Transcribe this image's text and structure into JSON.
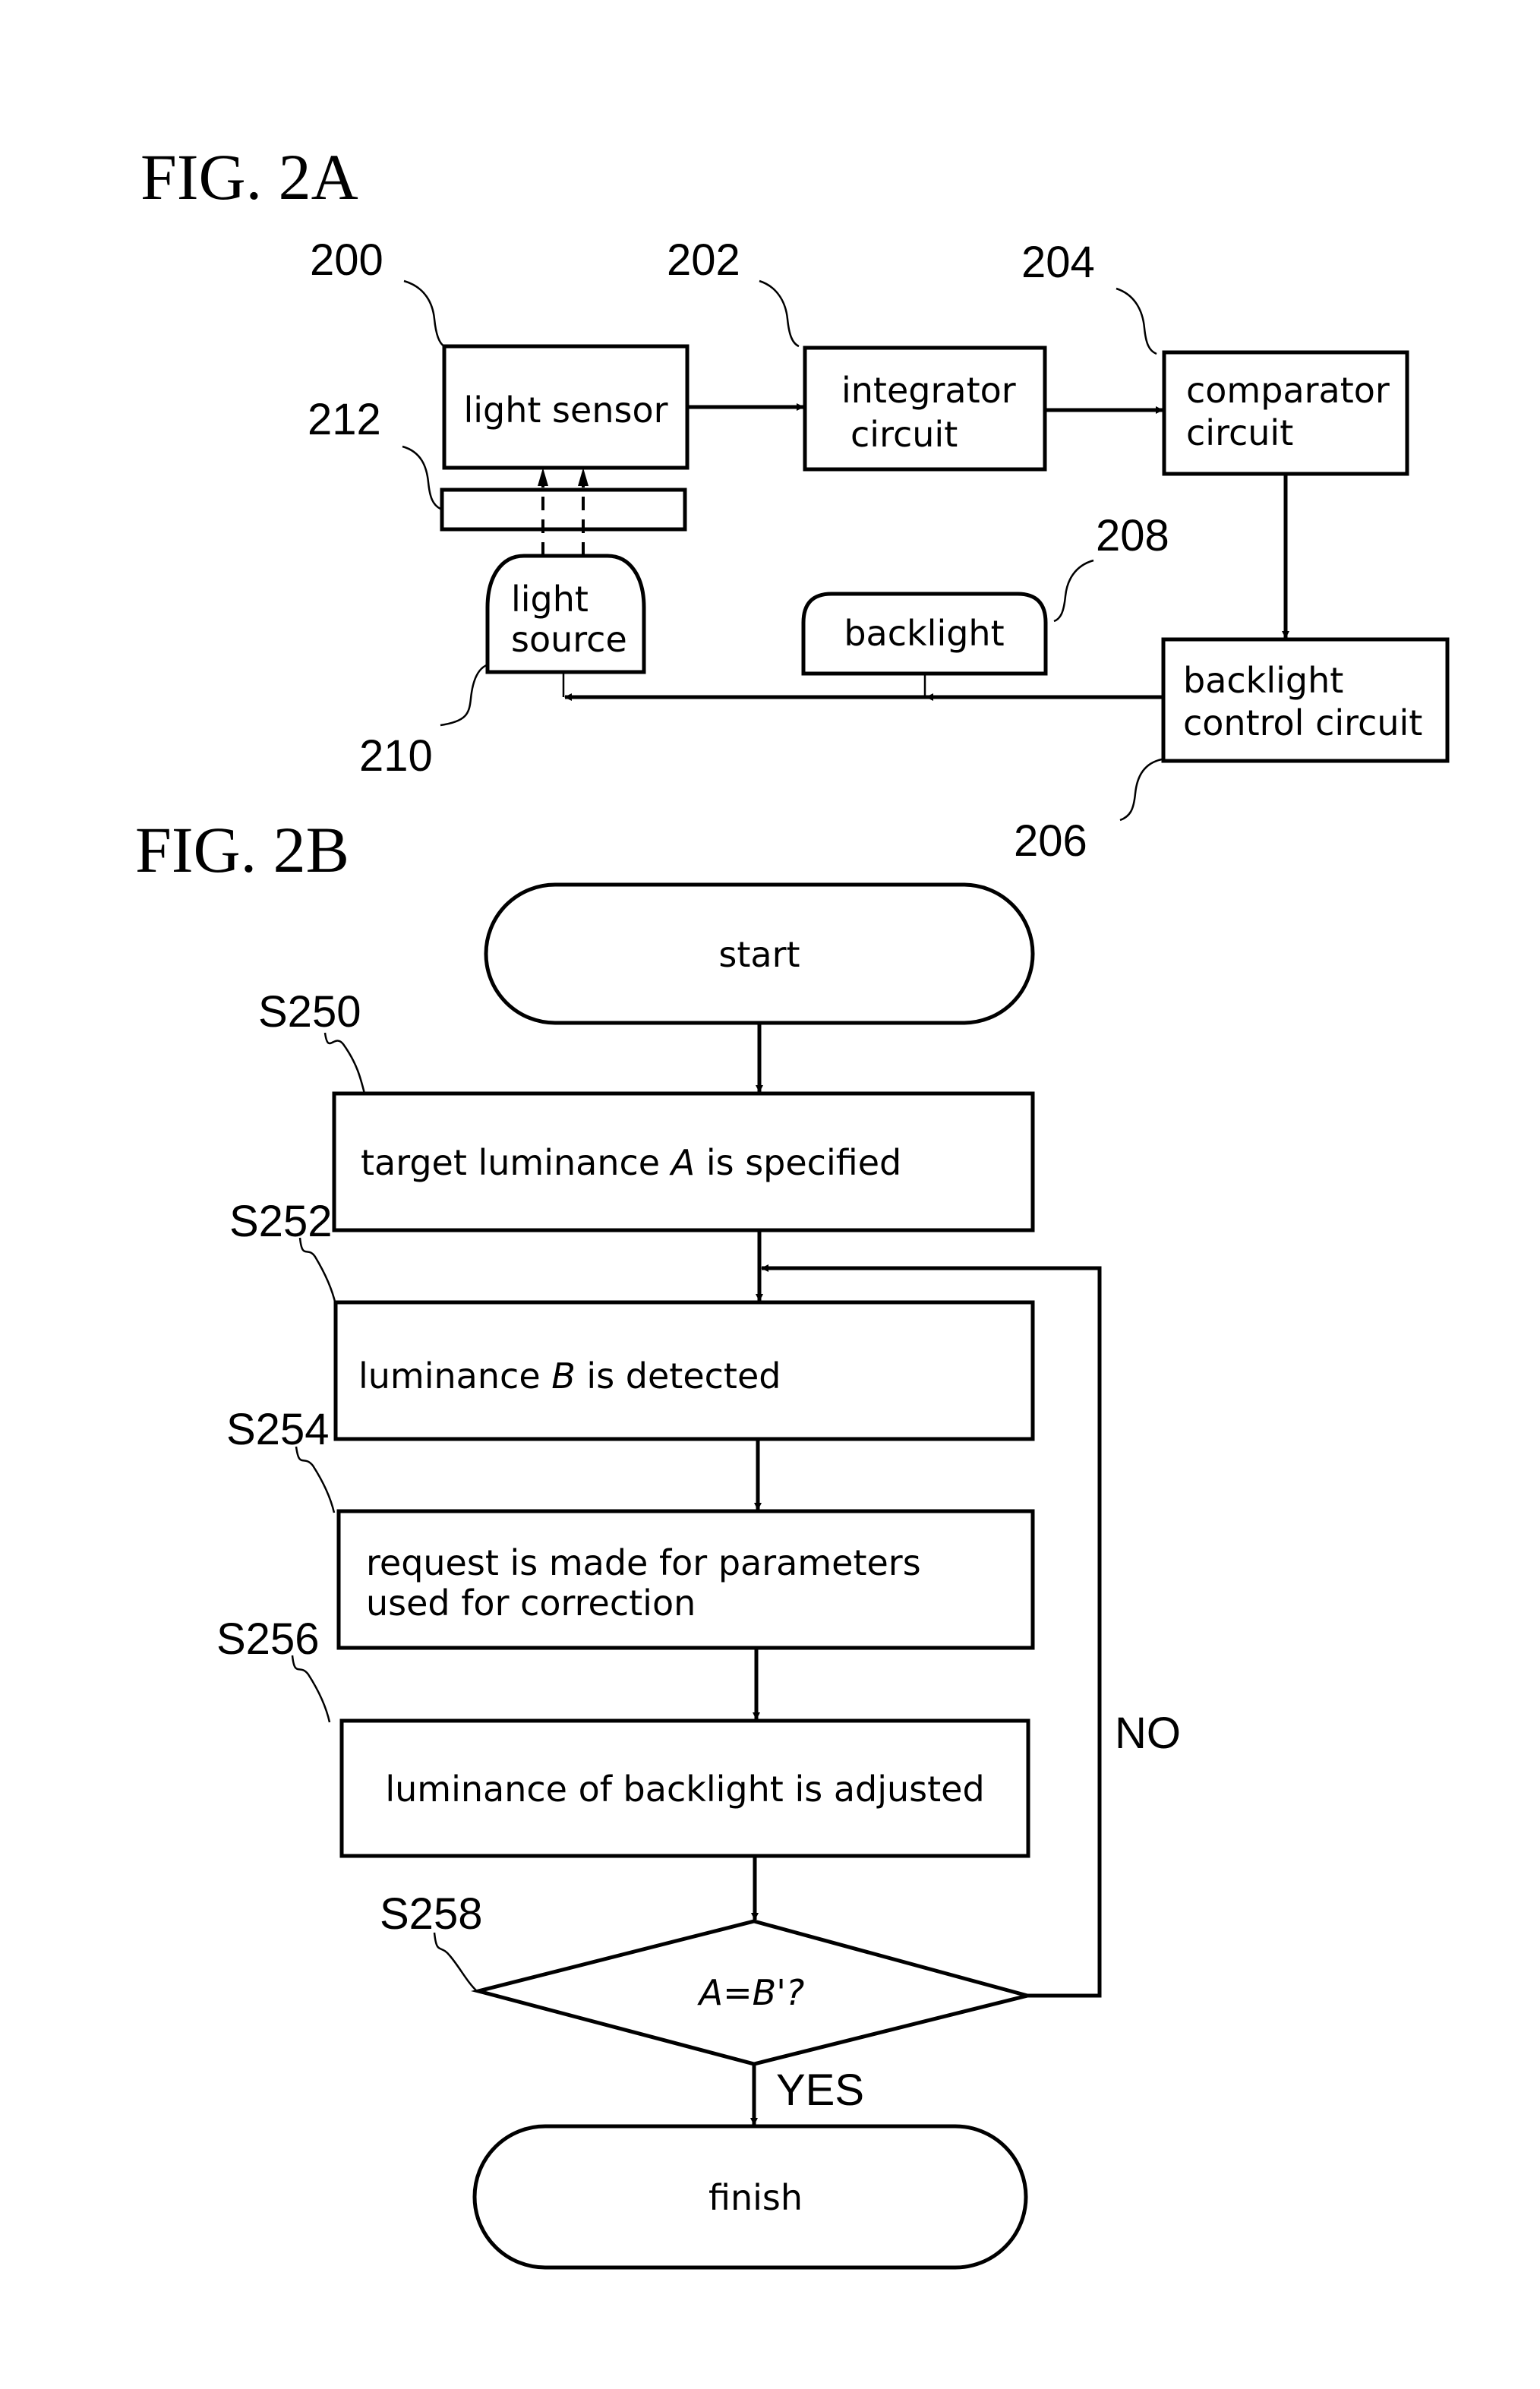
{
  "fig2a": {
    "title": "FIG. 2A",
    "refs": {
      "r200": "200",
      "r202": "202",
      "r204": "204",
      "r206": "206",
      "r208": "208",
      "r210": "210",
      "r212": "212"
    },
    "blocks": {
      "light_sensor": "light sensor",
      "integrator_l1": "integrator",
      "integrator_l2": "circuit",
      "comparator_l1": "comparator",
      "comparator_l2": "circuit",
      "backlight": "backlight",
      "light_source_l1": "light",
      "light_source_l2": "source",
      "backlight_ctrl_l1": "backlight",
      "backlight_ctrl_l2": "control circuit"
    }
  },
  "fig2b": {
    "title": "FIG. 2B",
    "start": "start",
    "finish": "finish",
    "steps": {
      "s250": {
        "id": "S250",
        "pre": "target luminance ",
        "var": "A",
        "post": " is specified"
      },
      "s252": {
        "id": "S252",
        "pre": "luminance ",
        "var": "B",
        "post": "  is detected"
      },
      "s254": {
        "id": "S254",
        "line1": "request is made for parameters",
        "line2": "used for correction"
      },
      "s256": {
        "id": "S256",
        "text": "luminance of backlight is adjusted"
      },
      "s258": {
        "id": "S258",
        "text": "A=B'?"
      }
    },
    "no_label": "NO",
    "yes_label": "YES"
  }
}
